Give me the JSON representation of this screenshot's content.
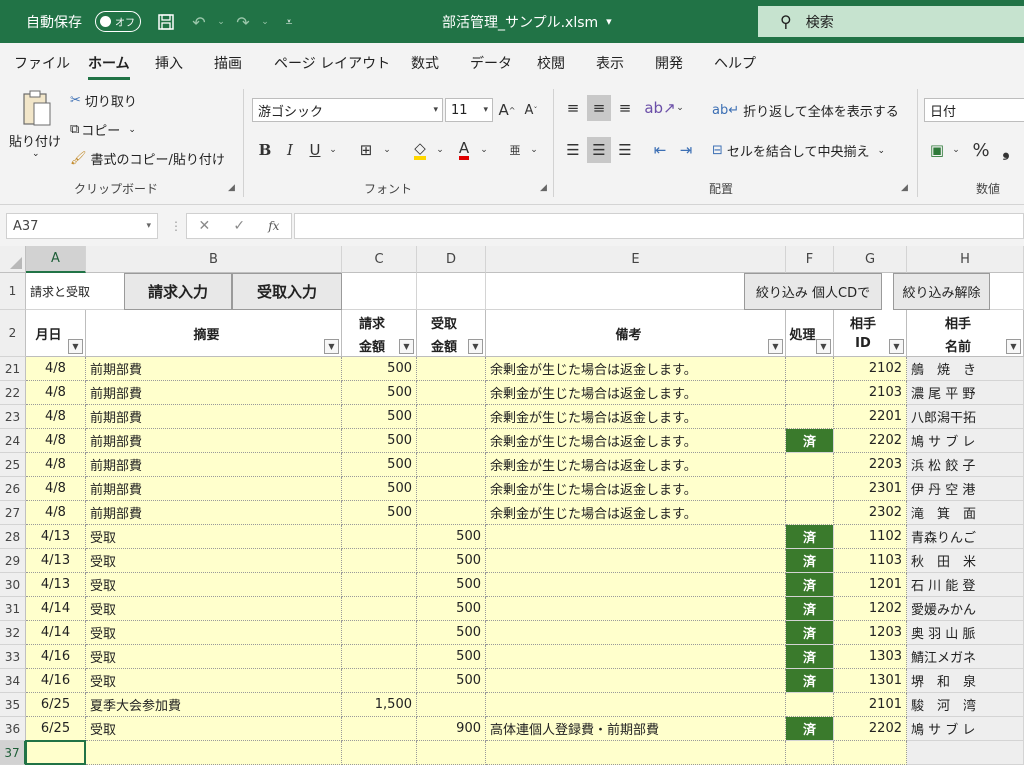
{
  "titlebar": {
    "autosave_label": "自動保存",
    "autosave_state": "オフ",
    "filename": "部活管理_サンプル.xlsm",
    "filename_caret": "▾",
    "search_placeholder": "検索"
  },
  "tabs": [
    "ファイル",
    "ホーム",
    "挿入",
    "描画",
    "ページ レイアウト",
    "数式",
    "データ",
    "校閲",
    "表示",
    "開発",
    "ヘルプ"
  ],
  "active_tab": "ホーム",
  "ribbon": {
    "paste_label": "貼り付け",
    "cut_label": "切り取り",
    "copy_label": "コピー",
    "format_painter_label": "書式のコピー/貼り付け",
    "clipboard_group": "クリップボード",
    "font_name": "游ゴシック",
    "font_size": "11",
    "bold": "B",
    "italic": "I",
    "underline": "U",
    "font_group": "フォント",
    "wrap_label": "折り返して全体を表示する",
    "merge_label": "セルを結合して中央揃え",
    "alignment_group": "配置",
    "number_format": "日付",
    "percent": "%",
    "comma": "❟",
    "number_group": "数値"
  },
  "formula_bar": {
    "name_box": "A37",
    "cancel": "✕",
    "enter": "✓",
    "fx": "fx",
    "formula": ""
  },
  "columns": [
    "A",
    "B",
    "C",
    "D",
    "E",
    "F",
    "G",
    "H"
  ],
  "active_column": "A",
  "row1": {
    "a_label": "請求と受取",
    "invoice_button": "請求入力",
    "receive_button": "受取入力",
    "filter_button": "絞り込み 個人CDで",
    "clear_filter_button": "絞り込み解除"
  },
  "headers": {
    "a": "月日",
    "b": "摘要",
    "c1": "請求",
    "c2": "金額",
    "d1": "受取",
    "d2": "金額",
    "e": "備考",
    "f": "処理",
    "g1": "相手",
    "g2": "ID",
    "h1": "相手",
    "h2": "名前"
  },
  "rows": [
    {
      "row": "21",
      "date": "4/8",
      "desc": "前期部費",
      "bill": "500",
      "recv": "",
      "note": "余剰金が生じた場合は返金します。",
      "done": "",
      "id": "2102",
      "name": "鵃　焼　き"
    },
    {
      "row": "22",
      "date": "4/8",
      "desc": "前期部費",
      "bill": "500",
      "recv": "",
      "note": "余剰金が生じた場合は返金します。",
      "done": "",
      "id": "2103",
      "name": "濃 尾 平 野"
    },
    {
      "row": "23",
      "date": "4/8",
      "desc": "前期部費",
      "bill": "500",
      "recv": "",
      "note": "余剰金が生じた場合は返金します。",
      "done": "",
      "id": "2201",
      "name": "八郎潟干拓"
    },
    {
      "row": "24",
      "date": "4/8",
      "desc": "前期部費",
      "bill": "500",
      "recv": "",
      "note": "余剰金が生じた場合は返金します。",
      "done": "済",
      "id": "2202",
      "name": "鳩 サ ブ レ"
    },
    {
      "row": "25",
      "date": "4/8",
      "desc": "前期部費",
      "bill": "500",
      "recv": "",
      "note": "余剰金が生じた場合は返金します。",
      "done": "",
      "id": "2203",
      "name": "浜 松 餃 子"
    },
    {
      "row": "26",
      "date": "4/8",
      "desc": "前期部費",
      "bill": "500",
      "recv": "",
      "note": "余剰金が生じた場合は返金します。",
      "done": "",
      "id": "2301",
      "name": "伊 丹 空 港"
    },
    {
      "row": "27",
      "date": "4/8",
      "desc": "前期部費",
      "bill": "500",
      "recv": "",
      "note": "余剰金が生じた場合は返金します。",
      "done": "",
      "id": "2302",
      "name": "滝　箕　面"
    },
    {
      "row": "28",
      "date": "4/13",
      "desc": "受取",
      "bill": "",
      "recv": "500",
      "note": "",
      "done": "済",
      "id": "1102",
      "name": "青森りんご"
    },
    {
      "row": "29",
      "date": "4/13",
      "desc": "受取",
      "bill": "",
      "recv": "500",
      "note": "",
      "done": "済",
      "id": "1103",
      "name": "秋　田　米"
    },
    {
      "row": "30",
      "date": "4/13",
      "desc": "受取",
      "bill": "",
      "recv": "500",
      "note": "",
      "done": "済",
      "id": "1201",
      "name": "石 川 能 登"
    },
    {
      "row": "31",
      "date": "4/14",
      "desc": "受取",
      "bill": "",
      "recv": "500",
      "note": "",
      "done": "済",
      "id": "1202",
      "name": "愛媛みかん"
    },
    {
      "row": "32",
      "date": "4/14",
      "desc": "受取",
      "bill": "",
      "recv": "500",
      "note": "",
      "done": "済",
      "id": "1203",
      "name": "奥 羽 山 脈"
    },
    {
      "row": "33",
      "date": "4/16",
      "desc": "受取",
      "bill": "",
      "recv": "500",
      "note": "",
      "done": "済",
      "id": "1303",
      "name": "鯖江メガネ"
    },
    {
      "row": "34",
      "date": "4/16",
      "desc": "受取",
      "bill": "",
      "recv": "500",
      "note": "",
      "done": "済",
      "id": "1301",
      "name": "堺　和　泉"
    },
    {
      "row": "35",
      "date": "6/25",
      "desc": "夏季大会参加費",
      "bill": "1,500",
      "recv": "",
      "note": "",
      "done": "",
      "id": "2101",
      "name": "駿　河　湾"
    },
    {
      "row": "36",
      "date": "6/25",
      "desc": "受取",
      "bill": "",
      "recv": "900",
      "note": "高体連個人登録費・前期部費",
      "done": "済",
      "id": "2202",
      "name": "鳩 サ ブ レ"
    },
    {
      "row": "37",
      "date": "",
      "desc": "",
      "bill": "",
      "recv": "",
      "note": "",
      "done": "",
      "id": "",
      "name": ""
    }
  ],
  "row_numbers_top": [
    "1",
    "2"
  ]
}
